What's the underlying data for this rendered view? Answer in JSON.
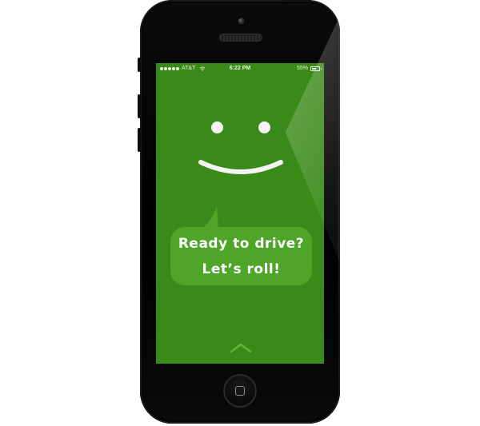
{
  "status_bar": {
    "carrier": "AT&T",
    "time": "6:22 PM",
    "battery_percent": "55%",
    "signal_icon": "signal-dots-icon",
    "wifi_icon": "wifi-icon",
    "battery_icon": "battery-icon"
  },
  "screen": {
    "background_color": "#3a8a19",
    "bubble_color": "#4ea52a",
    "message_line_1": "Ready to drive?",
    "message_line_2": "Let’s roll!",
    "face": {
      "eyes_icon": "eye-icon",
      "mouth_icon": "smile-icon"
    },
    "swipe_icon": "chevron-up-icon"
  },
  "device": {
    "home_button_icon": "home-button"
  }
}
